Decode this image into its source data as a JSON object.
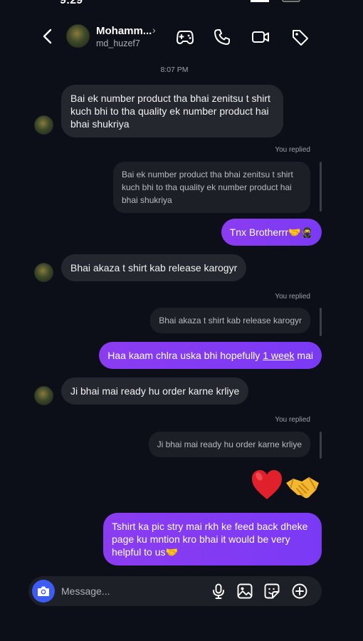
{
  "status": {
    "time": "9:29"
  },
  "header": {
    "name": "Mohamm...",
    "handle": "md_huzef7",
    "icons": [
      "back-chevron-icon",
      "gamepad-icon",
      "phone-icon",
      "video-icon",
      "tag-icon"
    ]
  },
  "thread": {
    "time_separator": "8:07 PM",
    "replied_label": "You replied",
    "messages": [
      {
        "from": "them",
        "text": "Bai ek number product tha bhai zenitsu t shirt kuch bhi to tha quality ek number product hai bhai shukriya"
      },
      {
        "from": "me",
        "quote": "Bai ek number product tha bhai zenitsu t shirt kuch bhi to tha quality ek number product hai bhai shukriya",
        "text": "Tnx Brotherrr🤝🥷"
      },
      {
        "from": "them",
        "text": "Bhai akaza t shirt kab release karogyr"
      },
      {
        "from": "me",
        "quote": "Bhai akaza t shirt kab release karogyr",
        "text_before": "Haa kaam chlra uska bhi hopefully ",
        "text_link": "1 week",
        "text_after": " mai"
      },
      {
        "from": "them",
        "text": "Ji bhai mai ready hu order karne krliye"
      },
      {
        "from": "me",
        "quote": "Ji bhai mai ready hu order karne krliye"
      },
      {
        "from": "me",
        "emoji": [
          "red-heart",
          "handshake"
        ]
      },
      {
        "from": "me",
        "text": "Tshirt ka pic stry mai rkh ke feed back dheke page ku mntion kro bhai it would be very helpful to us🤝"
      }
    ]
  },
  "composer": {
    "placeholder": "Message...",
    "icons": [
      "camera-icon",
      "microphone-icon",
      "gallery-icon",
      "sticker-icon",
      "add-icon"
    ]
  },
  "colors": {
    "background": "#0c0f17",
    "incoming": "#24272e",
    "outgoing": "#7a3af5",
    "camera": "#3d5cf5"
  }
}
